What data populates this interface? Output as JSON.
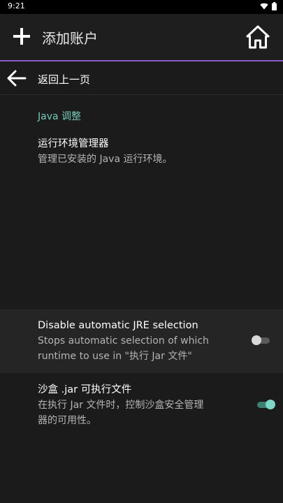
{
  "status_bar": {
    "time": "9:21",
    "icons": [
      "wifi-icon",
      "battery-icon"
    ]
  },
  "app_bar": {
    "add_icon": "plus-icon",
    "title": "添加账户",
    "home_icon": "home-icon",
    "accent_color": "#8a5cc7"
  },
  "back_row": {
    "icon": "arrow-left-icon",
    "label": "返回上一页"
  },
  "java_section": {
    "header": "Java 调整",
    "header_color": "#75c8b8",
    "items": [
      {
        "title": "运行环境管理器",
        "summary": "管理已安装的 Java 运行环境。"
      },
      {
        "title": "Disable automatic JRE selection",
        "summary_line1": "Stops automatic selection of which",
        "summary_line2": "runtime to use in \"执行 Jar 文件\"",
        "switch_on": false
      },
      {
        "title": "沙盒 .jar 可执行文件",
        "summary_line1": "在执行 Jar 文件时，控制沙盒安全管理",
        "summary_line2": "器的可用性。",
        "switch_on": true
      }
    ]
  }
}
